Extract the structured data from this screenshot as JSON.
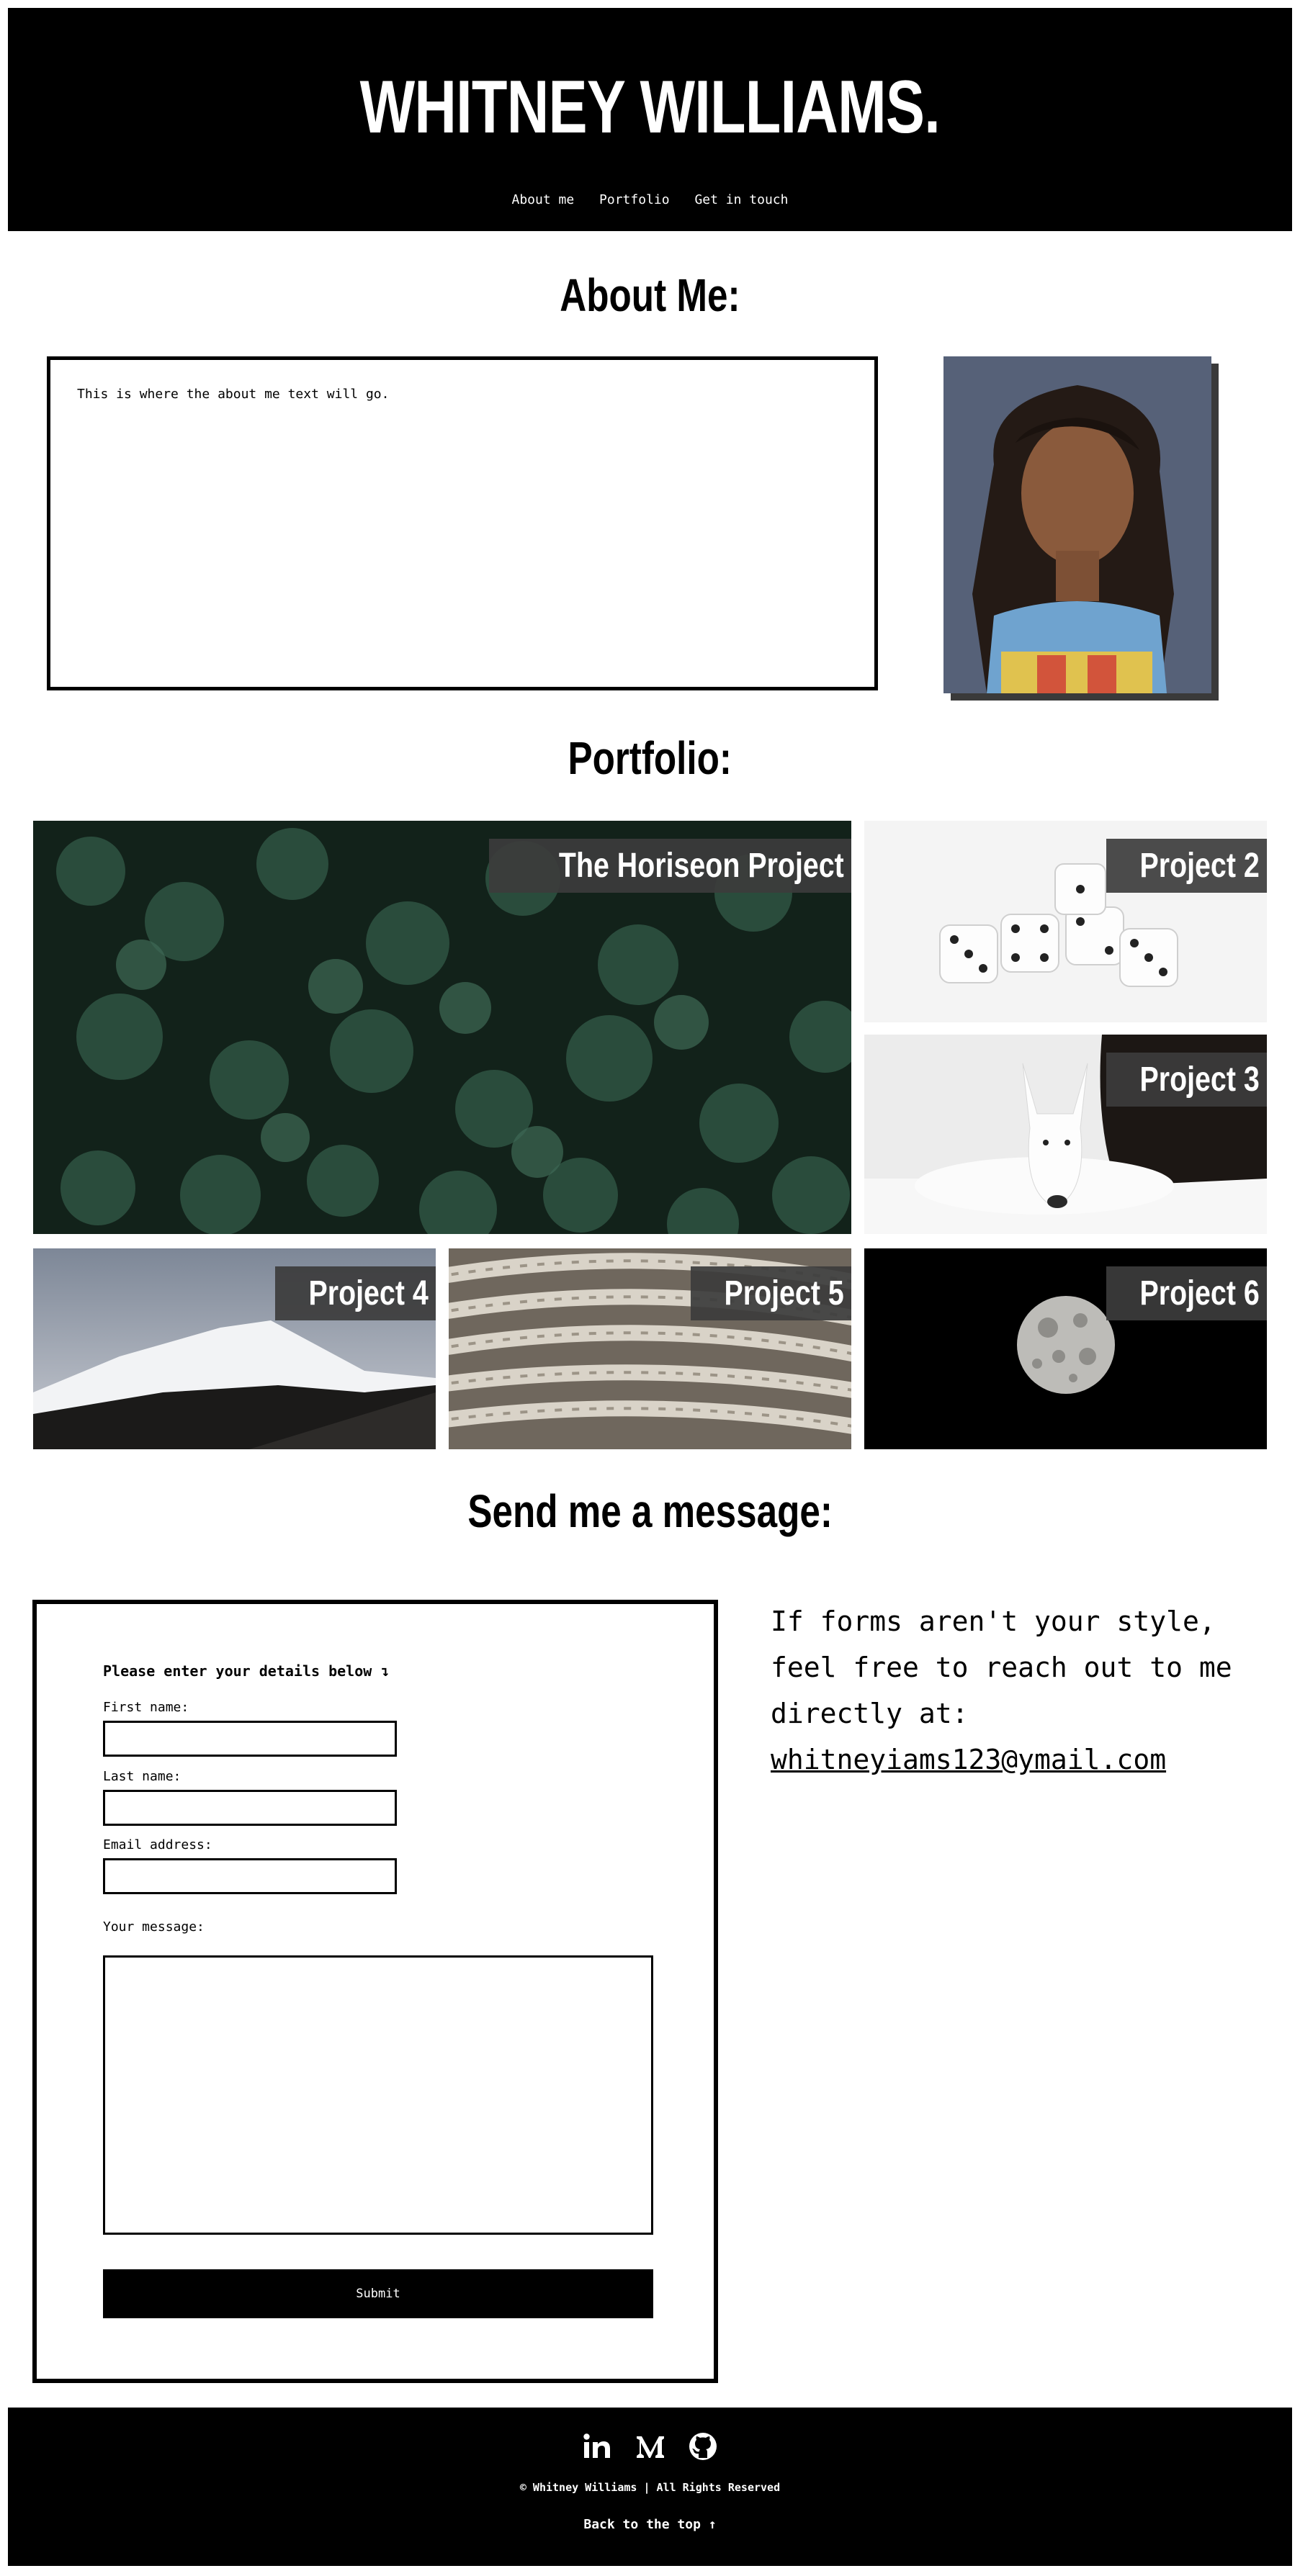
{
  "header": {
    "title": "WHITNEY WILLIAMS.",
    "nav": [
      "About me",
      "Portfolio",
      "Get in touch"
    ]
  },
  "about": {
    "heading": "About Me:",
    "text": "This is where the about me text will go."
  },
  "portfolio": {
    "heading": "Portfolio:",
    "projects": [
      {
        "title": "The Horiseon Project",
        "image": "green clover leaves with water droplets"
      },
      {
        "title": "Project 2",
        "image": "white dice"
      },
      {
        "title": "Project 3",
        "image": "white bull terrier dog"
      },
      {
        "title": "Project 4",
        "image": "snowy mountain"
      },
      {
        "title": "Project 5",
        "image": "coiled rope"
      },
      {
        "title": "Project 6",
        "image": "full moon on black sky"
      }
    ]
  },
  "contact": {
    "heading": "Send me a message:",
    "intro": "Please enter your details below ↴",
    "fields": {
      "first_name": "First name:",
      "last_name": "Last name:",
      "email": "Email address:",
      "message": "Your message:"
    },
    "submit_label": "Submit",
    "alt_text": "If forms aren't your style, feel free to reach out to me directly at:",
    "email": "whitneyiams123@ymail.com"
  },
  "footer": {
    "social_icons": [
      "linkedin-icon",
      "medium-icon",
      "github-icon"
    ],
    "copyright": "© Whitney Williams | All Rights Reserved",
    "back_to_top": "Back to the top ↑"
  }
}
